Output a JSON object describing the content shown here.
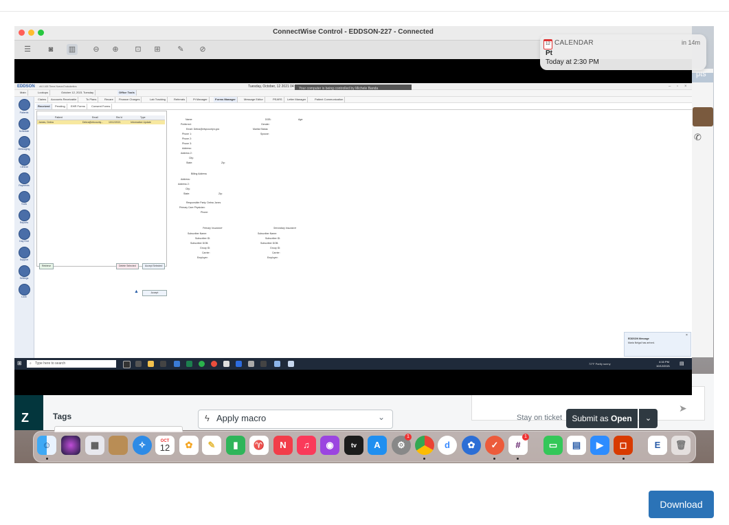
{
  "window": {
    "title": "ConnectWise Control - EDDSON-227 - Connected"
  },
  "notification": {
    "app": "CALENDAR",
    "time": "in 14m",
    "title": "Pt",
    "body": "Today at 2:30 PM",
    "cal_day": "12"
  },
  "background": {
    "partial_text": "pts"
  },
  "remote": {
    "logo": "EDDSON",
    "version": "v6.0.165  Tierra Nueva Endodontics",
    "date": "Tuesday, October, 12 2021 04:0",
    "control_bar": "Your computer is being controlled by Michele Banda",
    "tabs_top": [
      "Main",
      "Lookups",
      "October 12, 2021 Tuesday",
      "Office Tools"
    ],
    "tabs_second": [
      "Claims",
      "Accounts Receivable",
      "To Plans",
      "Recare",
      "Finance Charges",
      "Lab Tracking",
      "Referrals",
      "Pt Manager",
      "Forms Manager",
      "Message Editor",
      "PEARS",
      "Letter Manager",
      "Patient Communication"
    ],
    "tabs_third": [
      "Received",
      "Pending",
      "EHR Forms",
      "Consent Forms"
    ],
    "sidebar": [
      "Patients",
      "Schedule",
      "Messaging",
      "Clinical",
      "Payments",
      "Tools",
      "Reports",
      "Day End",
      "Support",
      "Settings",
      "Lock"
    ],
    "list_headers": [
      "Patient",
      "Email",
      "Rec'd",
      "Type"
    ],
    "list_row": [
      "James, Debra",
      "Debra@ebcounty...",
      "10/12/2021",
      "Information Update"
    ],
    "buttons": {
      "retrieve": "Retrieve",
      "delete": "Delete Selected",
      "accept_sel": "Accept Selected",
      "accept": "Accept"
    },
    "form_left": [
      "Name:",
      "Preferred:",
      "Email:  Debra@ebycountyn.gov",
      "Phone 1:",
      "Phone 2:",
      "Phone 3:",
      "Address:",
      "Address 2:",
      "City:",
      "State:"
    ],
    "form_right": [
      "DOB:",
      "Gender:",
      "Marital Status:",
      "Spouse:"
    ],
    "form_age": "Age:",
    "form_zip": "Zip:",
    "billing_title": "Billing Address",
    "billing": [
      "Address:",
      "Address 2:",
      "City:",
      "State:"
    ],
    "billing_zip": "Zip:",
    "responsible": "Responsible Party:  Debra Jones",
    "pcp": "Primary Care Physician:",
    "phone": "Phone:",
    "primary_ins": "Primary Insurance",
    "secondary_ins": "Secondary Insurance",
    "ins_fields": [
      "Subscriber Name:",
      "Subscriber ID:",
      "Subscriber DOB:",
      "Group ID:",
      "Carrier:",
      "Employer:"
    ],
    "notif_title": "EDDSON Message",
    "notif_body": "Maria Nelgal has arrived.",
    "search_placeholder": "Type here to search",
    "weather": "72°F  Partly sunny",
    "clock_time": "4:16 PM",
    "clock_date": "10/12/2021"
  },
  "zendesk": {
    "tags_label": "Tags",
    "macro_label": "Apply macro",
    "stay_label": "Stay on ticket",
    "submit_label": "Submit as",
    "submit_status": "Open",
    "send_label": "Send"
  },
  "dock": {
    "items": [
      "Finder",
      "Siri",
      "Launchpad",
      "Contacts",
      "Safari",
      "Calendar",
      "Photos",
      "Notes",
      "Numbers",
      "Keynote",
      "News",
      "Music",
      "Podcasts",
      "TV",
      "App Store",
      "System Preferences",
      "Chrome",
      "Dictionary",
      "Connect",
      "Tasks",
      "Slack",
      "Messages",
      "Remote",
      "Zoom",
      "Office",
      "Eddson",
      "Trash"
    ],
    "calendar_month": "OCT",
    "calendar_day": "12",
    "system_prefs_badge": "1",
    "slack_badge": "1"
  },
  "download_label": "Download"
}
